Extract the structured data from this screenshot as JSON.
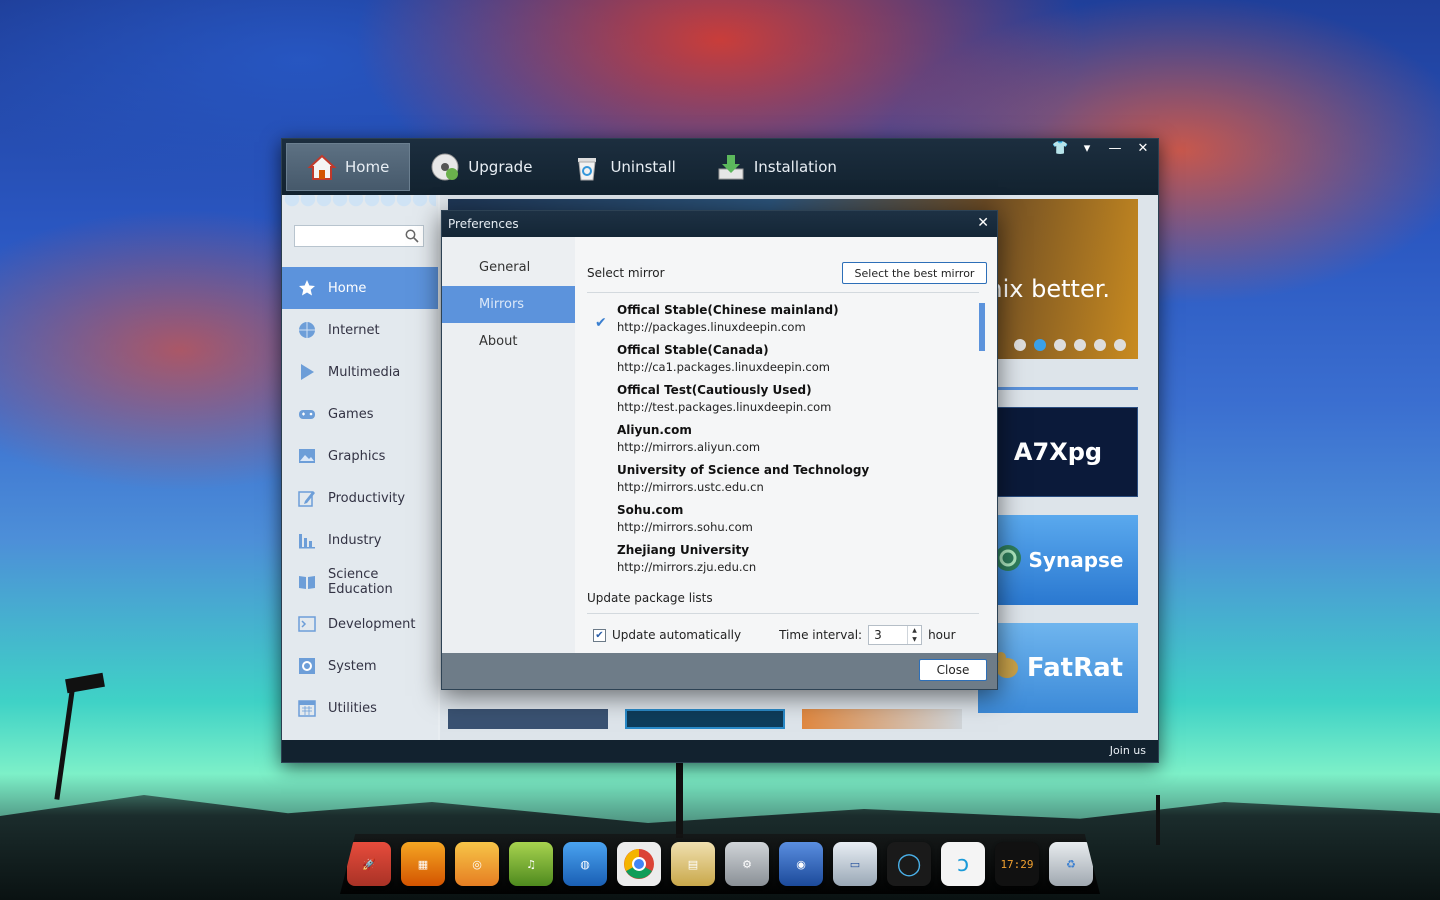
{
  "main_window": {
    "tabs": [
      {
        "label": "Home",
        "icon": "house-icon"
      },
      {
        "label": "Upgrade",
        "icon": "disc-icon"
      },
      {
        "label": "Uninstall",
        "icon": "recycle-bin-icon"
      },
      {
        "label": "Installation",
        "icon": "download-tray-icon"
      }
    ],
    "sidebar": {
      "items": [
        {
          "label": "Home",
          "icon": "star-icon"
        },
        {
          "label": "Internet",
          "icon": "globe-icon"
        },
        {
          "label": "Multimedia",
          "icon": "play-icon"
        },
        {
          "label": "Games",
          "icon": "gamepad-icon"
        },
        {
          "label": "Graphics",
          "icon": "image-icon"
        },
        {
          "label": "Productivity",
          "icon": "pencil-icon"
        },
        {
          "label": "Industry",
          "icon": "bar-chart-icon"
        },
        {
          "label": "Science Education",
          "icon": "book-icon"
        },
        {
          "label": "Development",
          "icon": "terminal-icon"
        },
        {
          "label": "System",
          "icon": "gear-icon"
        },
        {
          "label": "Utilities",
          "icon": "calendar-icon"
        }
      ]
    },
    "banner_text": "nix better.",
    "banner_slide_active": 2,
    "banner_slide_count": 6,
    "tiles": [
      "A7Xpg",
      "Synapse",
      "FatRat"
    ],
    "footer_link": "Join us"
  },
  "dialog": {
    "title": "Preferences",
    "nav": [
      "General",
      "Mirrors",
      "About"
    ],
    "select_mirror_label": "Select mirror",
    "best_mirror_button": "Select the best mirror",
    "mirrors": [
      {
        "name": "Offical Stable(Chinese mainland)",
        "url": "http://packages.linuxdeepin.com",
        "selected": true
      },
      {
        "name": "Offical Stable(Canada)",
        "url": "http://ca1.packages.linuxdeepin.com",
        "selected": false
      },
      {
        "name": "Offical Test(Cautiously Used)",
        "url": "http://test.packages.linuxdeepin.com",
        "selected": false
      },
      {
        "name": "Aliyun.com",
        "url": "http://mirrors.aliyun.com",
        "selected": false
      },
      {
        "name": "University of Science and Technology",
        "url": "http://mirrors.ustc.edu.cn",
        "selected": false
      },
      {
        "name": "Sohu.com",
        "url": "http://mirrors.sohu.com",
        "selected": false
      },
      {
        "name": "Zhejiang University",
        "url": "http://mirrors.zju.edu.cn",
        "selected": false
      }
    ],
    "update_section_label": "Update package lists",
    "update_auto_label": "Update automatically",
    "update_auto_checked": true,
    "interval_label": "Time interval:",
    "interval_value": "3",
    "interval_unit": "hour",
    "close_button": "Close"
  },
  "dock": {
    "clock_text": "17:29",
    "icons": [
      "rocket-icon",
      "presentation-icon",
      "spiral-icon",
      "music-icon",
      "globe-browser-icon",
      "chrome-icon",
      "file-manager-icon",
      "settings-icon",
      "earth-icon",
      "drive-icon",
      "circle-icon",
      "deepin-music-icon",
      "clock-icon",
      "trash-icon"
    ]
  },
  "colors": {
    "accent": "#5c93dc",
    "titlebar": "#1c2e3f"
  }
}
